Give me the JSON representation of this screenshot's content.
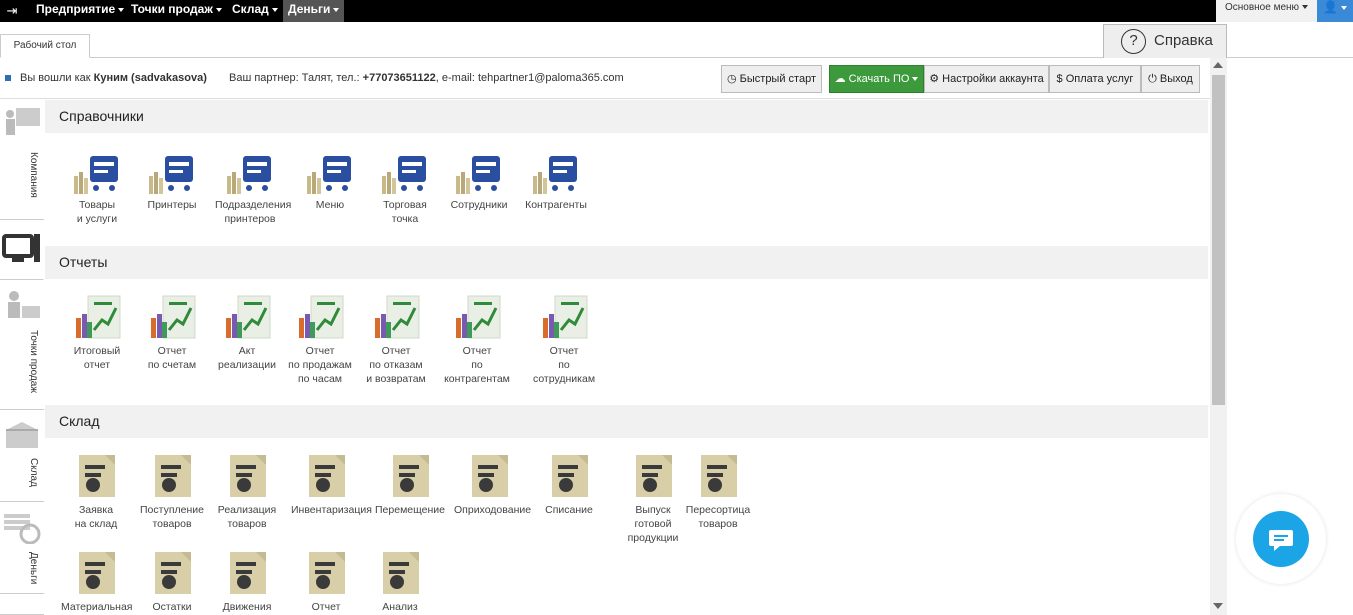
{
  "topnav": {
    "menus": [
      "Предприятие",
      "Точки продаж",
      "Склад",
      "Деньги"
    ],
    "active_menu": "Деньги",
    "main_menu": "Основное меню"
  },
  "tabs": {
    "desktop": "Рабочий стол"
  },
  "help": {
    "label": "Справка",
    "icon": "?"
  },
  "info": {
    "logged_prefix": "Вы вошли как ",
    "user": "Куним (sadvakasova)",
    "partner_prefix": "Ваш партнер: Талят, тел.: ",
    "phone": "+77073651122",
    "email_part": ", e-mail: tehpartner1@paloma365.com"
  },
  "buttons": {
    "quick_start": "Быстрый старт",
    "download": "Скачать ПО",
    "account_settings": "Настройки аккаунта",
    "payment": "Оплата услуг",
    "exit": "Выход"
  },
  "sidebar": [
    "Компания",
    "Точки продаж",
    "Склад",
    "Деньги"
  ],
  "sections": {
    "refs": {
      "title": "Справочники",
      "items": [
        "Товары\nи услуги",
        "Принтеры",
        "Подразделения\nпринтеров",
        "Меню",
        "Торговая\nточка",
        "Сотрудники",
        "Контрагенты"
      ]
    },
    "reports": {
      "title": "Отчеты",
      "items": [
        "Итоговый\nотчет",
        "Отчет\nпо счетам",
        "Акт\nреализации",
        "Отчет\nпо продажам\nпо часам",
        "Отчет\nпо отказам\nи возвратам",
        "Отчет\nпо контрагентам",
        "Отчет\nпо сотрудникам"
      ]
    },
    "stock": {
      "title": "Склад",
      "items": [
        "Заявка\nна склад",
        "Поступление\nтоваров",
        "Реализация\nтоваров",
        "Инвентаризация",
        "Перемещение",
        "Оприходование",
        "Списание",
        "Выпуск\nготовой\nпродукции",
        "Пересортица\nтоваров"
      ],
      "items2": [
        "Материальная",
        "Остатки",
        "Движения",
        "Отчет",
        "Анализ"
      ]
    }
  },
  "colors": {
    "accent": "#2b4fa0",
    "green": "#2f8a3a",
    "button_green": "#3c9a3c",
    "chat": "#1ba5e6"
  }
}
